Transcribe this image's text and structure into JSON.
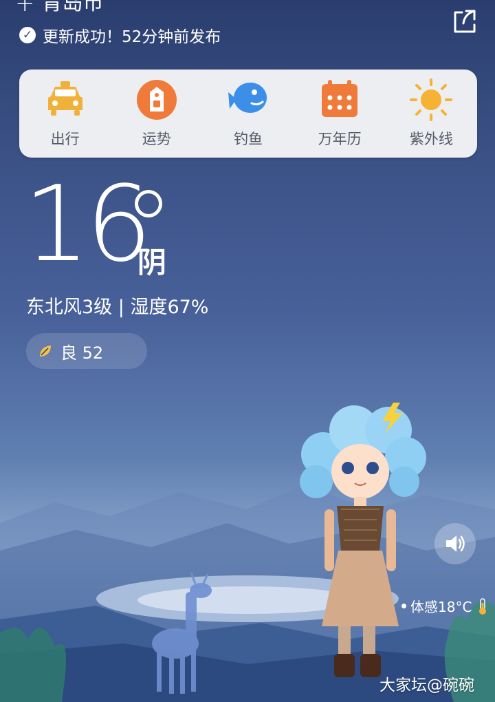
{
  "header": {
    "city": "青岛市",
    "status": "更新成功！52分钟前发布"
  },
  "services": [
    {
      "label": "出行",
      "icon": "taxi-icon",
      "color": "#f0b13a"
    },
    {
      "label": "运势",
      "icon": "fortune-icon",
      "color": "#f07a3a"
    },
    {
      "label": "钓鱼",
      "icon": "fish-icon",
      "color": "#3b8fe8"
    },
    {
      "label": "万年历",
      "icon": "calendar-icon",
      "color": "#f07a3a"
    },
    {
      "label": "紫外线",
      "icon": "sun-icon",
      "color": "#f5b234"
    }
  ],
  "weather": {
    "temperature": "16",
    "condition": "阴",
    "wind_humidity": "东北风3级 | 湿度67%",
    "aqi_label": "良 52",
    "feels_like": "体感18°C"
  },
  "watermark": "大家坛@碗碗",
  "colors": {
    "card_bg": "#eceef2",
    "aqi_leaf": "#f3c24a"
  }
}
